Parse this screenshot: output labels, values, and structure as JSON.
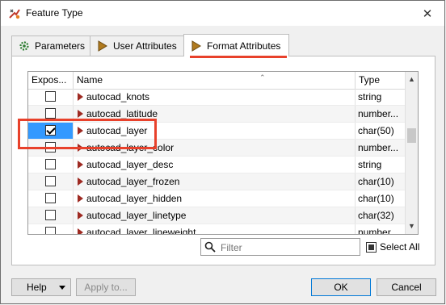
{
  "window": {
    "title": "Feature Type"
  },
  "tabs": [
    {
      "label": "Parameters"
    },
    {
      "label": "User Attributes"
    },
    {
      "label": "Format Attributes"
    }
  ],
  "table": {
    "columns": {
      "exposed": "Expos...",
      "name": "Name",
      "type": "Type"
    },
    "rows": [
      {
        "name": "autocad_knots",
        "type": "string",
        "checked": false
      },
      {
        "name": "autocad_latitude",
        "type": "number...",
        "checked": false
      },
      {
        "name": "autocad_layer",
        "type": "char(50)",
        "checked": true
      },
      {
        "name": "autocad_layer_color",
        "type": "number...",
        "checked": false
      },
      {
        "name": "autocad_layer_desc",
        "type": "string",
        "checked": false
      },
      {
        "name": "autocad_layer_frozen",
        "type": "char(10)",
        "checked": false
      },
      {
        "name": "autocad_layer_hidden",
        "type": "char(10)",
        "checked": false
      },
      {
        "name": "autocad_layer_linetype",
        "type": "char(32)",
        "checked": false
      },
      {
        "name": "autocad_layer_lineweight",
        "type": "number...",
        "checked": false
      }
    ]
  },
  "filter": {
    "placeholder": "Filter"
  },
  "select_all": {
    "label": "Select All"
  },
  "buttons": {
    "help": "Help",
    "apply": "Apply to...",
    "ok": "OK",
    "cancel": "Cancel"
  },
  "colors": {
    "highlight": "#e8412b",
    "selection": "#3399ff",
    "attr_icon": "#9e2a22"
  }
}
